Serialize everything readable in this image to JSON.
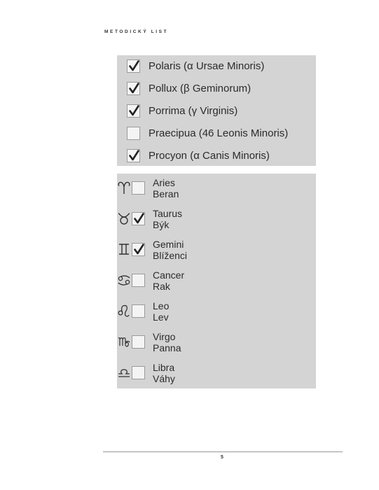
{
  "header": {
    "title": "METODICKÝ LIST"
  },
  "stars": [
    {
      "label": "Polaris (α Ursae Minoris)",
      "checked": true
    },
    {
      "label": "Pollux (β Geminorum)",
      "checked": true
    },
    {
      "label": "Porrima (γ Virginis)",
      "checked": true
    },
    {
      "label": "Praecipua (46 Leonis Minoris)",
      "checked": false
    },
    {
      "label": "Procyon (α Canis Minoris)",
      "checked": true
    }
  ],
  "zodiac": [
    {
      "latin": "Aries",
      "czech": "Beran",
      "icon": "aries-icon",
      "checked": false
    },
    {
      "latin": "Taurus",
      "czech": "Býk",
      "icon": "taurus-icon",
      "checked": true
    },
    {
      "latin": "Gemini",
      "czech": "Blíženci",
      "icon": "gemini-icon",
      "checked": true
    },
    {
      "latin": "Cancer",
      "czech": "Rak",
      "icon": "cancer-icon",
      "checked": false
    },
    {
      "latin": "Leo",
      "czech": "Lev",
      "icon": "leo-icon",
      "checked": false
    },
    {
      "latin": "Virgo",
      "czech": "Panna",
      "icon": "virgo-icon",
      "checked": false
    },
    {
      "latin": "Libra",
      "czech": "Váhy",
      "icon": "libra-icon",
      "checked": false
    }
  ],
  "footer": {
    "page_number": "5"
  },
  "colors": {
    "panel": "#d4d4d5",
    "checkbox": "#f4f4f4",
    "text": "#2b2b2b"
  }
}
